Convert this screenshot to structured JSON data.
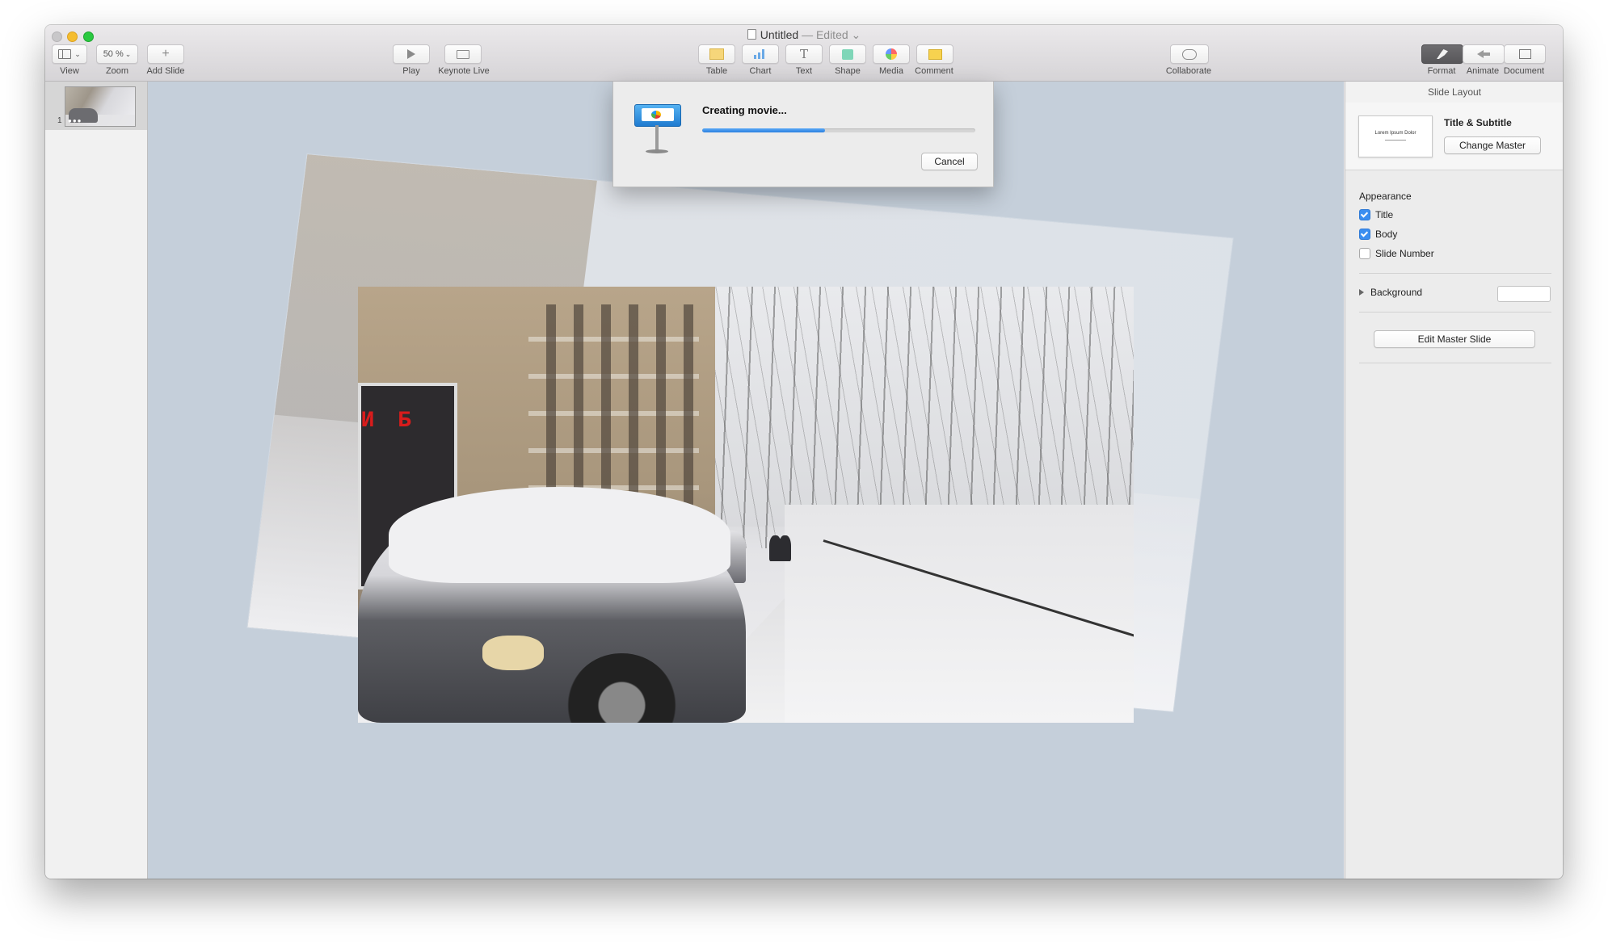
{
  "window": {
    "title": "Untitled",
    "edited": "— Edited"
  },
  "toolbar": {
    "view": "View",
    "zoom": "Zoom",
    "zoom_value": "50 %",
    "add_slide": "Add Slide",
    "play": "Play",
    "keynote_live": "Keynote Live",
    "table": "Table",
    "chart": "Chart",
    "text": "Text",
    "shape": "Shape",
    "media": "Media",
    "comment": "Comment",
    "collaborate": "Collaborate",
    "format": "Format",
    "animate": "Animate",
    "document": "Document"
  },
  "navigator": {
    "slide_number": "1"
  },
  "dialog": {
    "title": "Creating movie...",
    "progress": 0.45,
    "cancel": "Cancel"
  },
  "inspector": {
    "header": "Slide Layout",
    "master_thumb_text": "Lorem Ipsum Dolor",
    "master_name": "Title & Subtitle",
    "change_master": "Change Master",
    "appearance": "Appearance",
    "checkboxes": [
      {
        "label": "Title",
        "checked": true
      },
      {
        "label": "Body",
        "checked": true
      },
      {
        "label": "Slide Number",
        "checked": false
      }
    ],
    "background": "Background",
    "edit_master": "Edit Master Slide"
  },
  "colors": {
    "accent": "#3b8ef0",
    "canvas": "#c5cfda",
    "sign_red": "#d81c1c"
  },
  "slide_image": {
    "sign_text": "НИ Б"
  }
}
